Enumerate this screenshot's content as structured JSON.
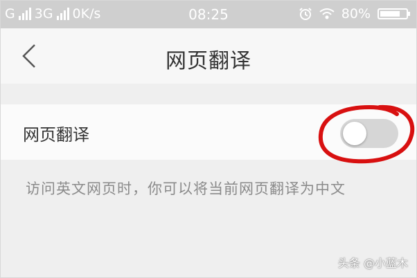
{
  "status_bar": {
    "carrier1": "G",
    "carrier2": "3G",
    "speed": "0K/s",
    "time": "08:25",
    "battery": "80%",
    "battery_level": 0.8,
    "icons": [
      "signal-icon",
      "alarm-icon",
      "wifi-icon",
      "battery-icon"
    ]
  },
  "header": {
    "title": "网页翻译"
  },
  "setting": {
    "label": "网页翻译",
    "enabled": false,
    "highlight_color": "#d81010"
  },
  "description": "访问英文网页时，你可以将当前网页翻译为中文",
  "watermark": "头条 @小蓝木"
}
